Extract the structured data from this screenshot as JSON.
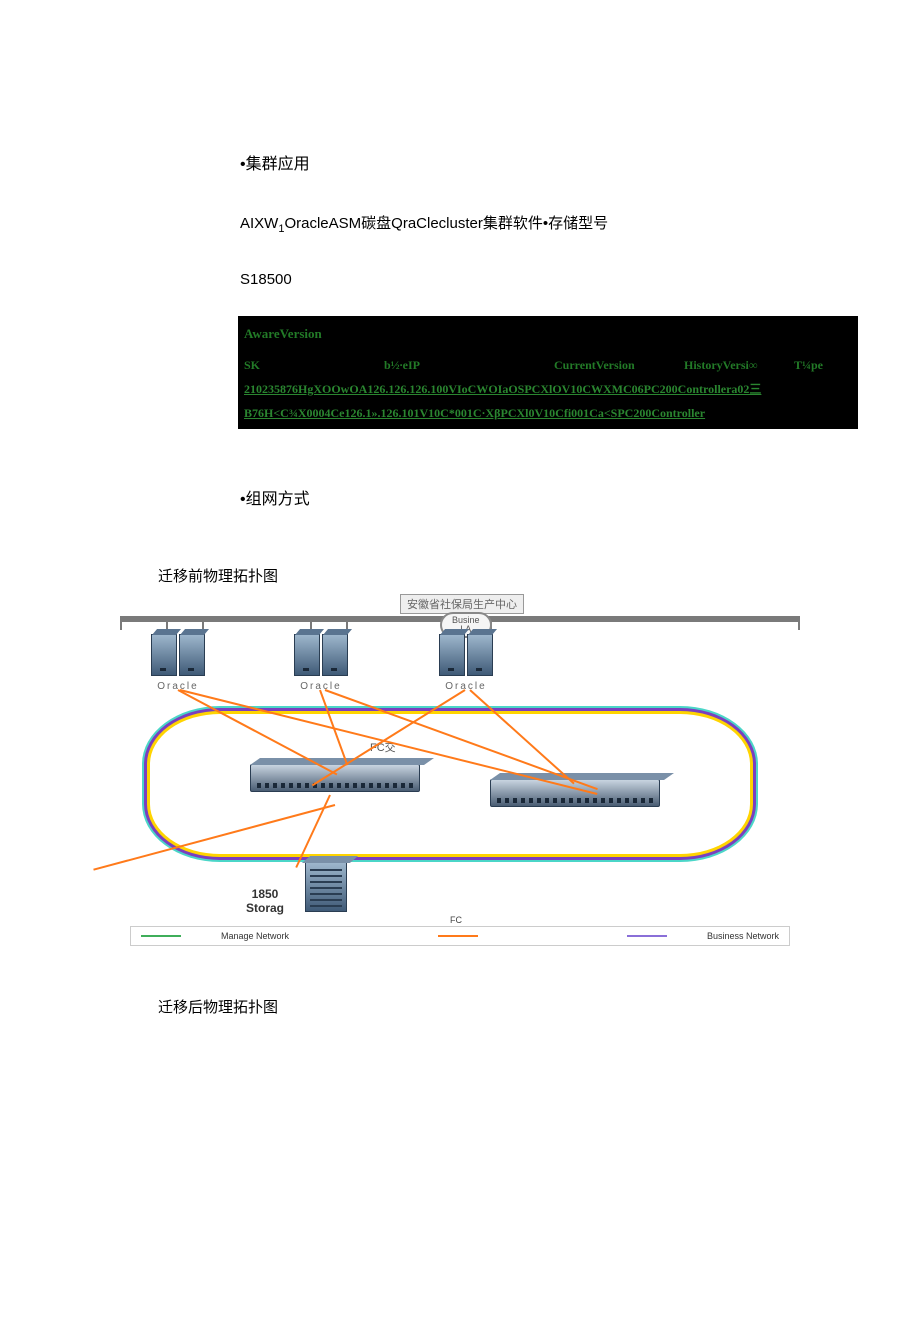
{
  "section1": {
    "bullet": "•集群应用",
    "desc_prefix": "AIXW",
    "desc_sub": "1",
    "desc_suffix": "OracleASM碳盘QraClecluster集群软件•存储型号",
    "serial": "S18500"
  },
  "terminal": {
    "aware_version": "AwareVersion",
    "headers": {
      "c0": "SK",
      "c1": "b½∙eIP",
      "c2": "CurrentVersion",
      "c3": "HistoryVersi∞",
      "c4": "T¼pe"
    },
    "lines": {
      "l1": "210235876HgXOOwOA126.126.126.100VIoCWOIaOSPCXlOV10CWXMC06PC200Controllera02三",
      "l2": "B76H<C¾X0004Ce126.1».126.101V10C*001C·XβPCXl0V10Cfi001Ca<SPC200Controller"
    }
  },
  "section2": {
    "bullet": "•组网方式",
    "caption_before": "迁移前物理拓扑图",
    "caption_after": "迁移后物理拓扑图"
  },
  "diagram": {
    "title": "安徽省社保局生产中心",
    "busine": "Busine",
    "la": "LA",
    "oracle": "Oracle",
    "fc_label": "FC交",
    "storage_num": "1850",
    "storage_txt": "Storag",
    "legend_manage": "Manage Network",
    "legend_fc": "FC",
    "legend_business": "Business Network"
  }
}
